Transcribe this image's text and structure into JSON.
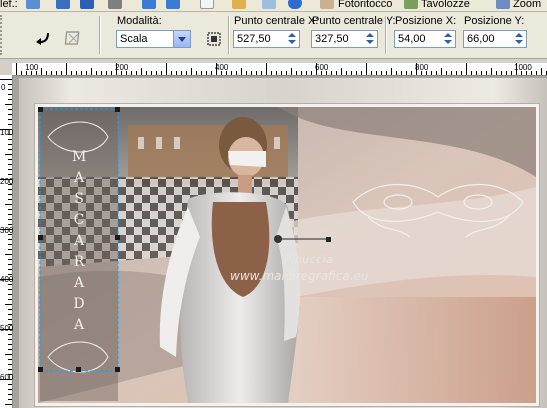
{
  "menu": {
    "left_fragment": "lef.:",
    "items": [
      "Fotoritocco",
      "Tavolozze",
      "Zoom"
    ]
  },
  "tool_options": {
    "mode": {
      "label": "Modalità:",
      "value": "Scala"
    },
    "center_x": {
      "label": "Punto centrale X:",
      "value": "527,50"
    },
    "center_y": {
      "label": "Punto centrale Y:",
      "value": "327,50"
    },
    "pos_x": {
      "label": "Posizione X:",
      "value": "54,00"
    },
    "pos_y": {
      "label": "Posizione Y:",
      "value": "66,00"
    }
  },
  "ruler_top": [
    "100",
    "200",
    "400",
    "600",
    "800",
    "1000"
  ],
  "ruler_left": [
    "0",
    "100",
    "200",
    "300",
    "400",
    "500",
    "600"
  ],
  "canvas": {
    "vertical_text": [
      "M",
      "A",
      "S",
      "C",
      "A",
      "R",
      "A",
      "D",
      "A"
    ],
    "watermark_name": "Pinuccia",
    "watermark_url": "www.maidiregrafica.eu"
  },
  "colors": {
    "toolbar_bg": "#ebe8dc",
    "spin_arrow": "#2f5fb0",
    "frame_bg": "#d5c4ba",
    "selection": "#00aaff"
  }
}
